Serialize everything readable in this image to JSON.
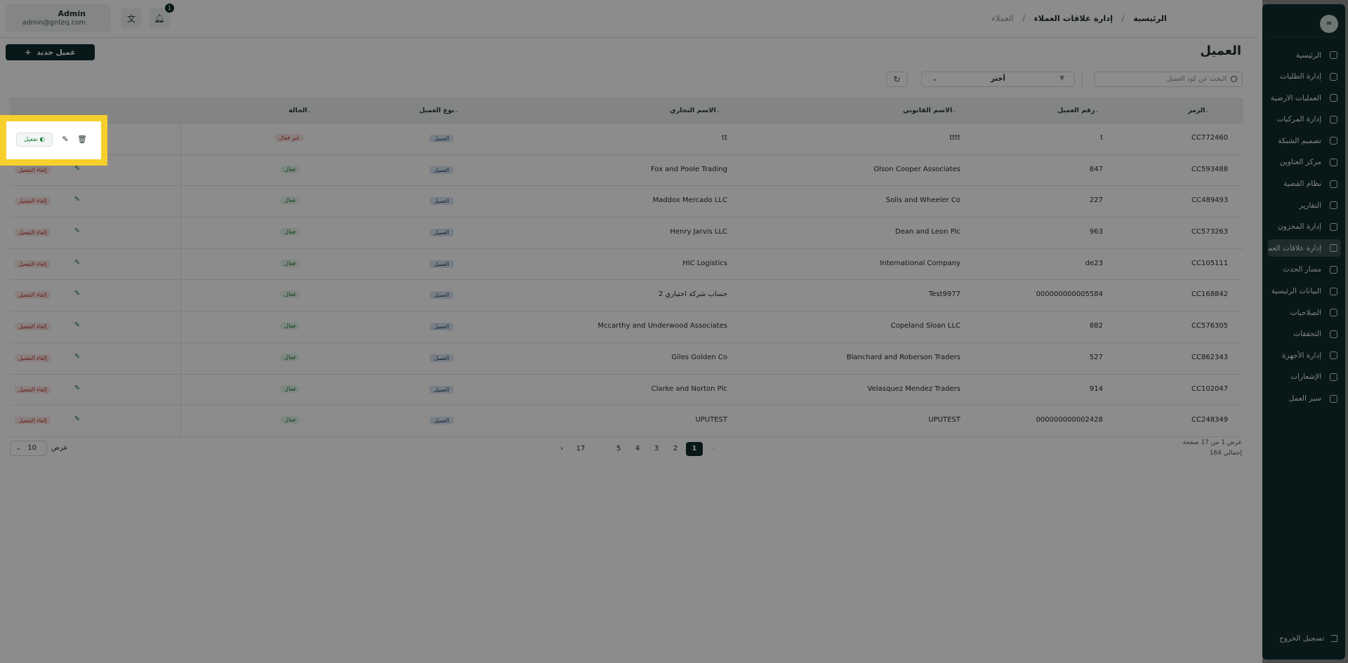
{
  "header": {
    "user_name": "Admin",
    "user_email": "admin@gnteq.com",
    "notification_count": "1",
    "translate_icon": "translate-icon",
    "bell_icon": "bell-icon"
  },
  "breadcrumb": {
    "home": "الرئيسية",
    "section": "إدارة علاقات العملاء",
    "current": "العملاء",
    "separator": "/"
  },
  "page": {
    "title": "العميل",
    "new_button": "عميل جديد",
    "search_placeholder": "البحث عن كود العميل",
    "filter_value": "أختر"
  },
  "sidebar": {
    "logo_text": "∞",
    "items": [
      {
        "label": "الرئيسية",
        "icon": "home-icon"
      },
      {
        "label": "إدارة الطلبات",
        "icon": "orders-icon"
      },
      {
        "label": "العمليات الارضية",
        "icon": "ground-ops-icon"
      },
      {
        "label": "إدارة المركبات",
        "icon": "truck-icon"
      },
      {
        "label": "تصميم الشبكة",
        "icon": "network-icon"
      },
      {
        "label": "مركز العناوين",
        "icon": "location-icon"
      },
      {
        "label": "نظام القضية",
        "icon": "case-icon"
      },
      {
        "label": "التقارير",
        "icon": "reports-icon"
      },
      {
        "label": "إدارة المخزون",
        "icon": "inventory-icon"
      },
      {
        "label": "إدارة علاقات العملاء",
        "icon": "crm-icon"
      },
      {
        "label": "مسار الحدث",
        "icon": "route-icon"
      },
      {
        "label": "البيانات الرئيسية",
        "icon": "database-icon"
      },
      {
        "label": "الصلاحيات",
        "icon": "users-icon"
      },
      {
        "label": "التحققات",
        "icon": "tools-icon"
      },
      {
        "label": "إدارة الأجهزة",
        "icon": "device-icon"
      },
      {
        "label": "الإشعارات",
        "icon": "bell-icon"
      },
      {
        "label": "سير العمل",
        "icon": "workflow-icon"
      }
    ],
    "active_index": 9,
    "logout": "تسجيل الخروج"
  },
  "table": {
    "columns": [
      "الرمز",
      "رقم العميل",
      "الاسم القانوني",
      "الاسم التجاري",
      "نوع العميل",
      "الحالة"
    ],
    "rows": [
      {
        "code": "CC772460",
        "number": "t",
        "legal": "tttt",
        "trade": "tt",
        "type": "العميل",
        "status": "غير فعال",
        "status_kind": "inactive"
      },
      {
        "code": "CC593488",
        "number": "847",
        "legal": "Olson Cooper Associates",
        "trade": "Fox and Poole Trading",
        "type": "العميل",
        "status": "فعال",
        "status_kind": "active"
      },
      {
        "code": "CC489493",
        "number": "227",
        "legal": "Solis and Wheeler Co",
        "trade": "Maddox Mercado LLC",
        "type": "العميل",
        "status": "فعال",
        "status_kind": "active"
      },
      {
        "code": "CC573263",
        "number": "963",
        "legal": "Dean and Leon Plc",
        "trade": "Henry Jarvis LLC",
        "type": "العميل",
        "status": "فعال",
        "status_kind": "active"
      },
      {
        "code": "CC105111",
        "number": "de23",
        "legal": "International Company",
        "trade": "HIC Logistics",
        "type": "العميل",
        "status": "فعال",
        "status_kind": "active"
      },
      {
        "code": "CC168842",
        "number": "000000000005584",
        "legal": "Test9977",
        "trade": "2 حساب شركة اختباري",
        "type": "العميل",
        "status": "فعال",
        "status_kind": "active"
      },
      {
        "code": "CC576305",
        "number": "882",
        "legal": "Copeland Sloan LLC",
        "trade": "Mccarthy and Underwood Associates",
        "type": "العميل",
        "status": "فعال",
        "status_kind": "active"
      },
      {
        "code": "CC862343",
        "number": "527",
        "legal": "Blanchard and Roberson Traders",
        "trade": "Giles Golden Co",
        "type": "العميل",
        "status": "فعال",
        "status_kind": "active"
      },
      {
        "code": "CC102047",
        "number": "914",
        "legal": "Velasquez Mendez Traders",
        "trade": "Clarke and Norton Plc",
        "type": "العميل",
        "status": "فعال",
        "status_kind": "active"
      },
      {
        "code": "CC248349",
        "number": "000000000002428",
        "legal": "UPUTEST",
        "trade": "UPUTEST",
        "type": "العميل",
        "status": "فعال",
        "status_kind": "active"
      }
    ],
    "activate_label": "تفعيل",
    "deactivate_label": "إلغاء التفعيل"
  },
  "pagination": {
    "pages": [
      "1",
      "2",
      "3",
      "4",
      "5",
      "...",
      "17"
    ],
    "current": "1",
    "per_page": "10",
    "per_page_label": "عرض",
    "info_line1": "عرض 1 من 17 صفحة",
    "info_line2": "إجمالي 164"
  },
  "colors": {
    "sidebar_bg": "#0f2a2b",
    "highlight": "#f6cf2c",
    "active_status": "#1f7a3e",
    "inactive_status": "#c0392b"
  }
}
